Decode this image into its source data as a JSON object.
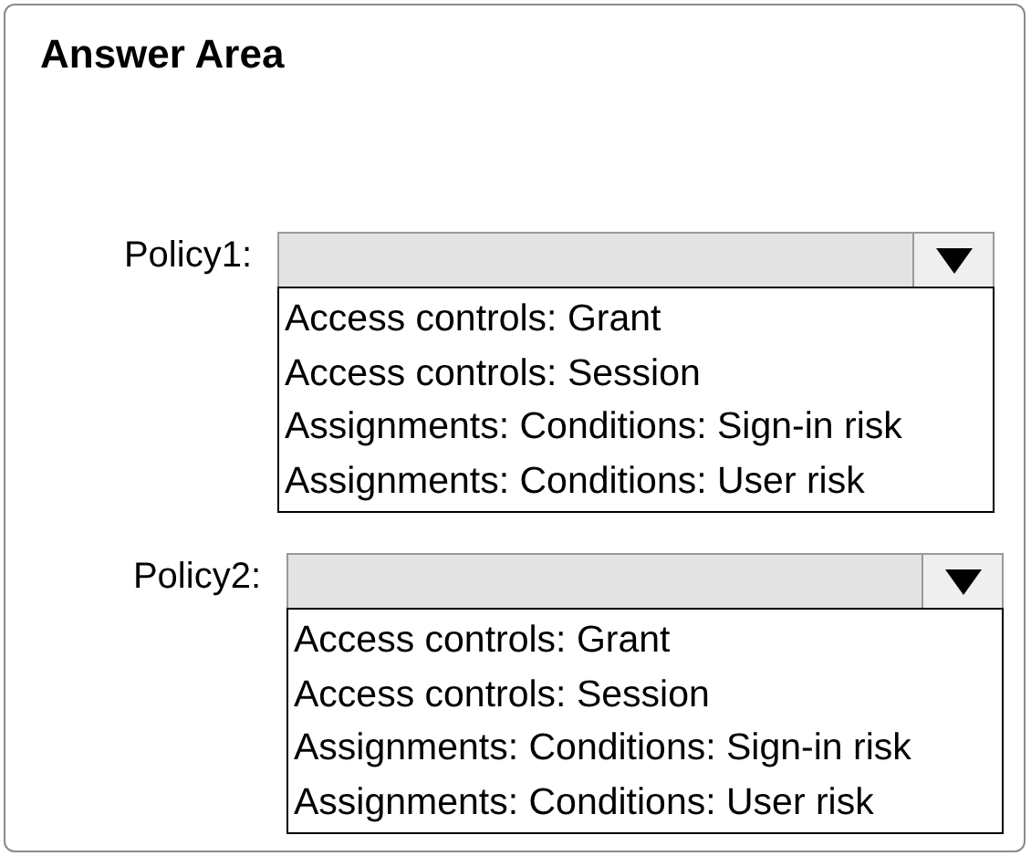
{
  "title": "Answer Area",
  "policies": [
    {
      "label": "Policy1:",
      "options": [
        {
          "text": "Access controls: Grant",
          "selected": false
        },
        {
          "text": "Access controls: Session",
          "selected": false
        },
        {
          "text": "Assignments: Conditions: Sign-in risk",
          "selected": false
        },
        {
          "text": "Assignments: Conditions: User risk",
          "selected": false
        }
      ]
    },
    {
      "label": "Policy2:",
      "options": [
        {
          "text": "Access controls: Grant",
          "selected": false
        },
        {
          "text": "Access controls: Session",
          "selected": false
        },
        {
          "text": "Assignments: Conditions: Sign-in risk",
          "selected": false
        },
        {
          "text": "Assignments: Conditions: User risk",
          "selected": false
        }
      ]
    }
  ]
}
